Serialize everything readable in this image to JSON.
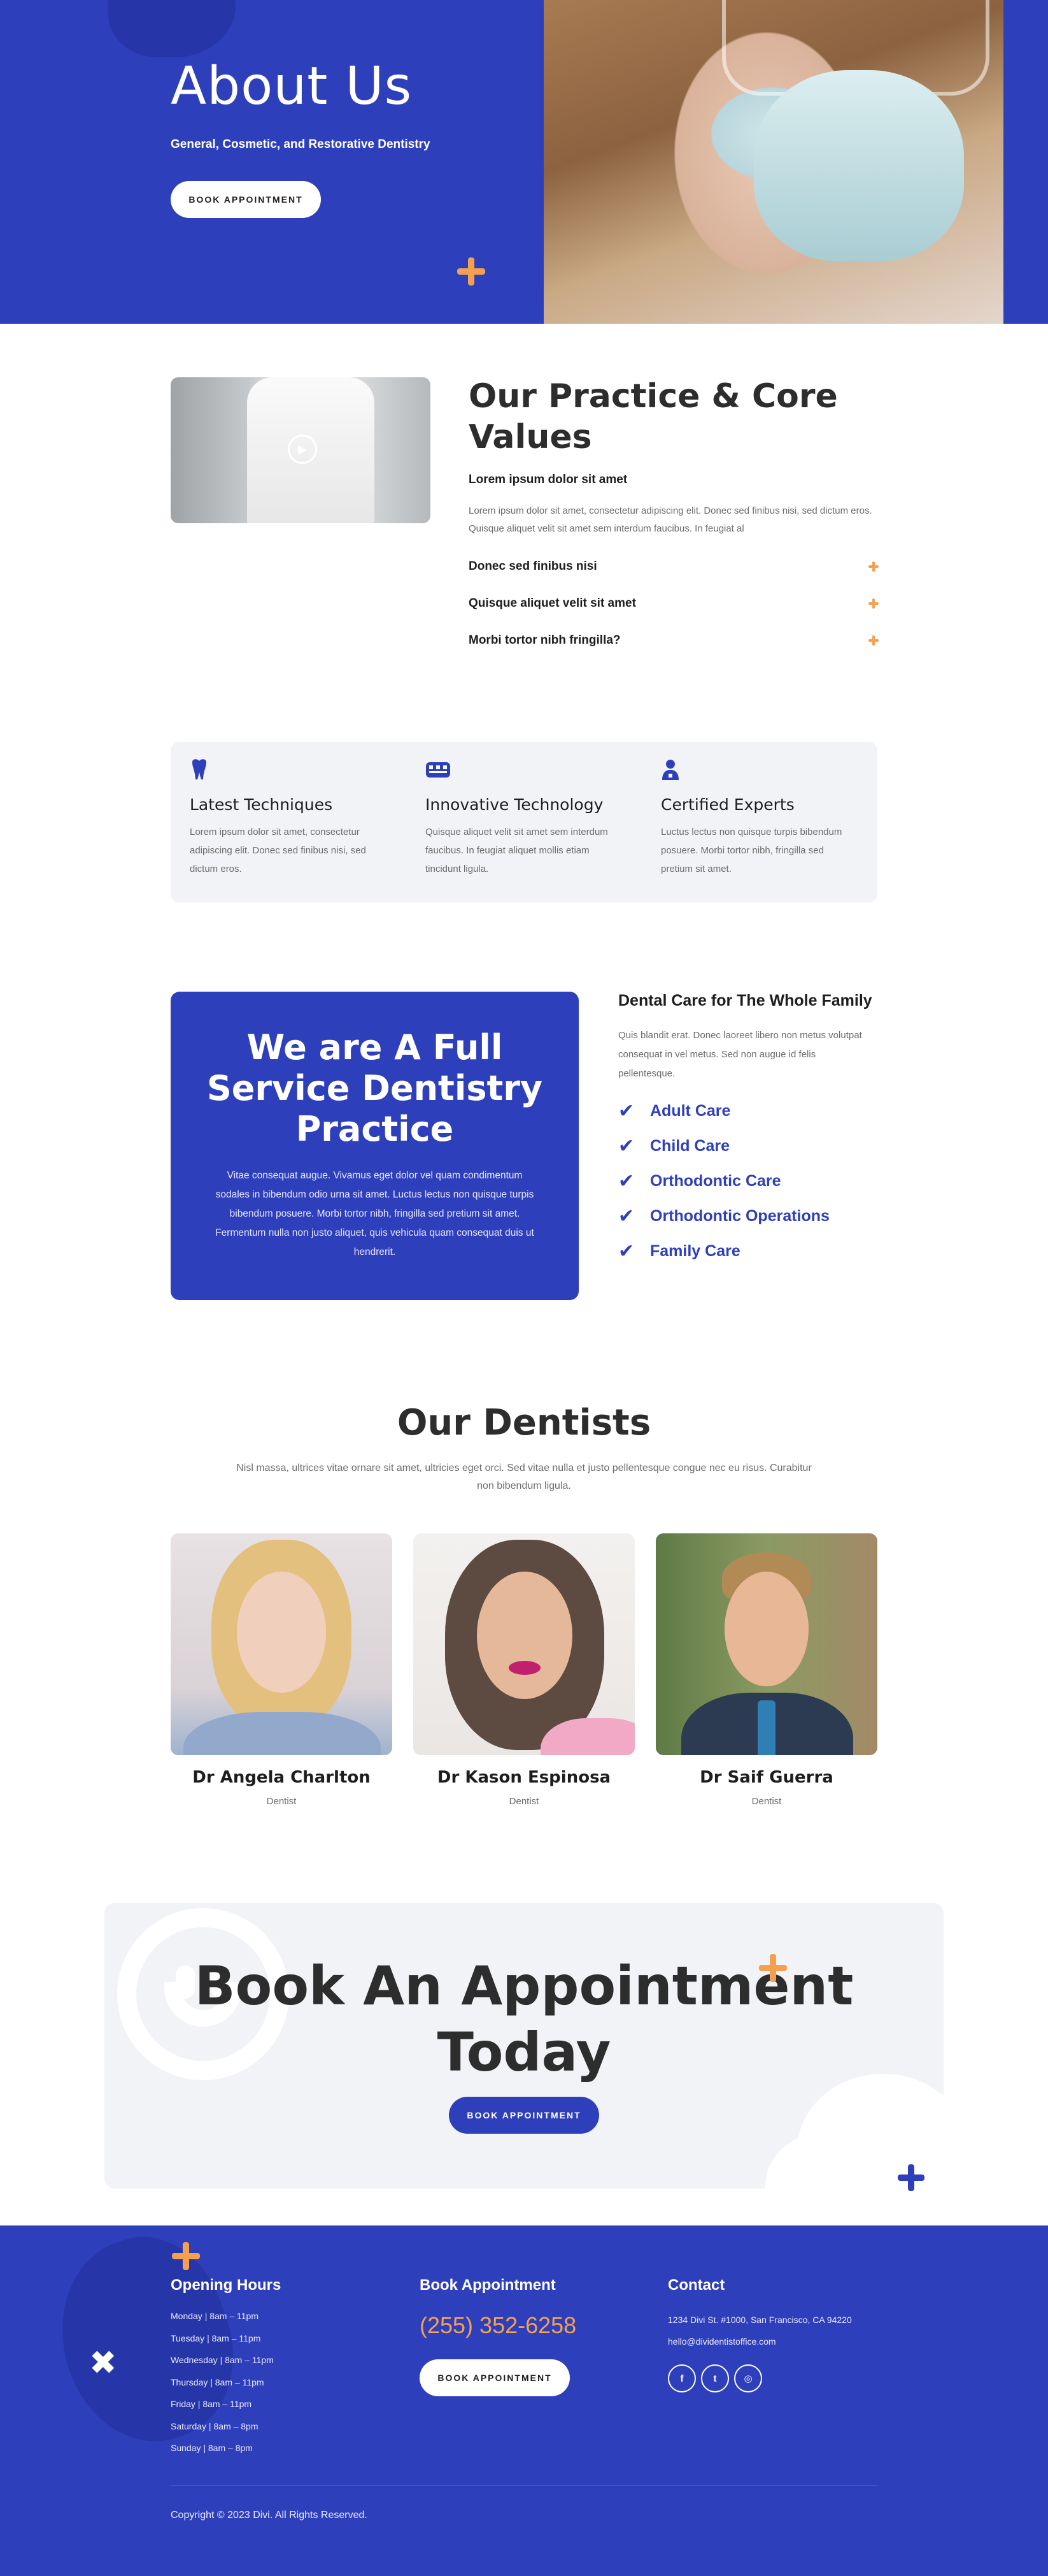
{
  "hero": {
    "title": "About Us",
    "subtitle": "General, Cosmetic, and Restorative Dentistry",
    "button_label": "BOOK APPOINTMENT"
  },
  "practice": {
    "title": "Our Practice & Core Values",
    "open_item": {
      "title": "Lorem ipsum dolor sit amet",
      "body": "Lorem ipsum dolor sit amet, consectetur adipiscing elit. Donec sed finibus nisi, sed dictum eros. Quisque aliquet velit sit amet sem interdum faucibus. In feugiat al"
    },
    "items": [
      {
        "label": "Donec sed finibus nisi"
      },
      {
        "label": "Quisque aliquet velit sit amet"
      },
      {
        "label": "Morbi tortor nibh fringilla?"
      }
    ]
  },
  "features": [
    {
      "icon": "tooth-icon",
      "title": "Latest Techniques",
      "text": "Lorem ipsum dolor sit amet, consectetur adipiscing elit. Donec sed finibus nisi, sed dictum eros."
    },
    {
      "icon": "technology-icon",
      "title": "Innovative Technology",
      "text": "Quisque aliquet velit sit amet sem interdum faucibus. In feugiat aliquet mollis etiam tincidunt ligula."
    },
    {
      "icon": "expert-icon",
      "title": "Certified Experts",
      "text": "Luctus lectus non quisque turpis bibendum posuere. Morbi tortor nibh, fringilla sed pretium sit amet."
    }
  ],
  "service": {
    "title": "We are A Full Service Dentistry Practice",
    "text": "Vitae consequat augue. Vivamus eget dolor vel quam condimentum sodales in bibendum odio urna sit amet. Luctus lectus non quisque turpis bibendum posuere. Morbi tortor nibh, fringilla sed pretium sit amet. Fermentum nulla non justo aliquet, quis vehicula quam consequat duis ut hendrerit.",
    "family_title": "Dental Care for The Whole Family",
    "family_text": "Quis blandit erat. Donec laoreet libero non metus volutpat consequat in vel metus. Sed non augue id felis pellentesque.",
    "care_items": [
      "Adult Care",
      "Child Care",
      "Orthodontic Care",
      "Orthodontic Operations",
      "Family Care"
    ]
  },
  "dentists": {
    "title": "Our Dentists",
    "subtitle": "Nisl massa, ultrices vitae ornare sit amet, ultricies eget orci. Sed vitae nulla et justo pellentesque congue nec eu risus. Curabitur non bibendum ligula.",
    "people": [
      {
        "name": "Dr Angela Charlton",
        "role": "Dentist"
      },
      {
        "name": "Dr Kason Espinosa",
        "role": "Dentist"
      },
      {
        "name": "Dr Saif Guerra",
        "role": "Dentist"
      }
    ]
  },
  "book": {
    "title": "Book An Appointment Today",
    "button_label": "BOOK APPOINTMENT"
  },
  "footer": {
    "hours_title": "Opening Hours",
    "hours": [
      "Monday | 8am – 11pm",
      "Tuesday | 8am – 11pm",
      "Wednesday | 8am – 11pm",
      "Thursday | 8am – 11pm",
      "Friday | 8am – 11pm",
      "Saturday | 8am – 8pm",
      "Sunday | 8am – 8pm"
    ],
    "book_title": "Book Appointment",
    "phone": "(255) 352-6258",
    "book_button": "BOOK APPOINTMENT",
    "contact_title": "Contact",
    "address": "1234 Divi St. #1000, San Francisco, CA 94220",
    "email": "hello@dividentistoffice.com",
    "socials": [
      {
        "icon": "facebook-icon",
        "glyph": "f"
      },
      {
        "icon": "twitter-icon",
        "glyph": "t"
      },
      {
        "icon": "instagram-icon",
        "glyph": "◎"
      }
    ],
    "copyright": "Copyright © 2023 Divi. All Rights Reserved."
  },
  "colors": {
    "brand_blue": "#2e3fbb",
    "accent_orange": "#f5a050",
    "light_gray": "#f1f3f6"
  }
}
